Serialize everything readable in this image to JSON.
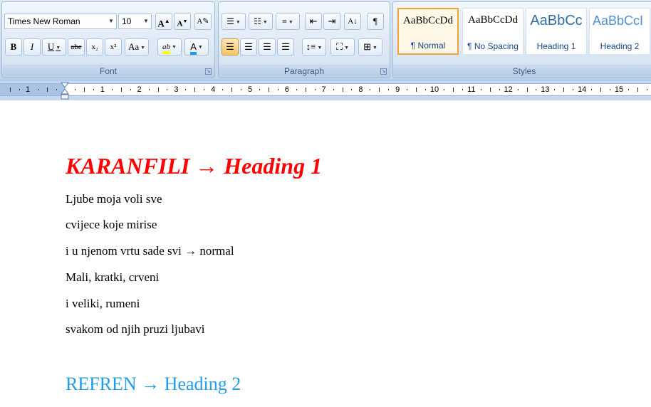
{
  "font_group": {
    "font_name": "Times New Roman",
    "font_size": "10",
    "grow_font_label": "A",
    "shrink_font_label": "A",
    "bold_label": "B",
    "italic_label": "I",
    "underline_label": "U",
    "strike_label": "abe",
    "subscript_label": "x₂",
    "superscript_label": "x²",
    "change_case_label": "Aa",
    "highlight_label": "ab",
    "font_color_label": "A",
    "group_label": "Font"
  },
  "paragraph_group": {
    "show_marks_label": "¶",
    "group_label": "Paragraph"
  },
  "styles_group": {
    "cards": [
      {
        "sample": "AaBbCcDd",
        "name": "¶ Normal"
      },
      {
        "sample": "AaBbCcDd",
        "name": "¶ No Spacing"
      },
      {
        "sample": "AaBbCc",
        "name": "Heading 1"
      },
      {
        "sample": "AaBbCcI",
        "name": "Heading 2"
      }
    ],
    "group_label": "Styles"
  },
  "ruler": {
    "left_numbers": [
      "1"
    ],
    "numbers": [
      "1",
      "2",
      "3",
      "4",
      "5",
      "6",
      "7",
      "8",
      "9",
      "10",
      "11",
      "12",
      "13",
      "14",
      "15"
    ]
  },
  "document": {
    "heading1": "KARANFILI → Heading 1",
    "lines": [
      "Ljube moja voli sve",
      "cvijece koje mirise",
      "i u njenom vrtu sade svi → normal",
      "Mali, kratki, crveni",
      "i veliki, rumeni",
      "svakom od njih pruzi ljubavi"
    ],
    "heading2": "REFREN → Heading 2"
  },
  "colors": {
    "heading1": "#ff0000",
    "heading2": "#1f9ee6",
    "highlight": "#ffff00",
    "font_color": "#1f9ee6",
    "active_style_border": "#f2a23b"
  }
}
